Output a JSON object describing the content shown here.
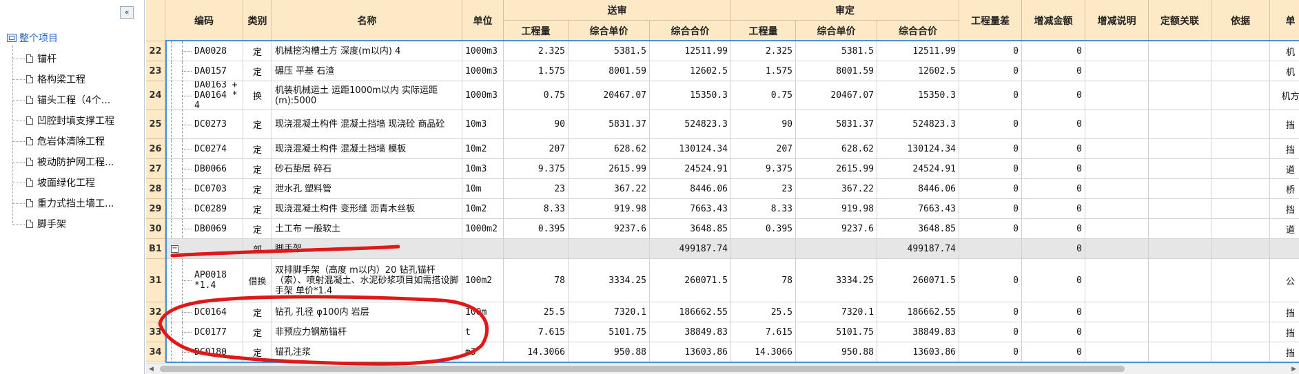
{
  "tree": {
    "collapse_glyph": "«",
    "root_label": "整个项目",
    "items": [
      "锚杆",
      "格构梁工程",
      "锚头工程（4个...",
      "凹腔封填支撑工程",
      "危岩体清除工程",
      "被动防护网工程...",
      "坡面绿化工程",
      "重力式挡土墙工...",
      "脚手架"
    ]
  },
  "header": {
    "code": "编码",
    "type": "类别",
    "name": "名称",
    "unit": "单位",
    "send_group": "送审",
    "approve_group": "审定",
    "qty": "工程量",
    "unit_price": "综合单价",
    "total": "综合合价",
    "qty_diff": "工程量差",
    "amount_diff": "增减金额",
    "diff_note": "增减说明",
    "quota_link": "定额关联",
    "basis": "依据",
    "extra": "单"
  },
  "rows": [
    {
      "num": "22",
      "code": "DA0028",
      "type": "定",
      "name": "机械挖沟槽土方 深度(m以内) 4",
      "unit": "1000m3",
      "q1": "2.325",
      "p1": "5381.5",
      "t1": "12511.99",
      "q2": "2.325",
      "p2": "5381.5",
      "t2": "12511.99",
      "qd": "0",
      "ad": "0",
      "tail": "机"
    },
    {
      "num": "23",
      "code": "DA0157",
      "type": "定",
      "name": "碾压 平基 石渣",
      "unit": "1000m3",
      "q1": "1.575",
      "p1": "8001.59",
      "t1": "12602.5",
      "q2": "1.575",
      "p2": "8001.59",
      "t2": "12602.5",
      "qd": "0",
      "ad": "0",
      "tail": "机"
    },
    {
      "num": "24",
      "code": "DA0163 + DA0164 * 4",
      "type": "换",
      "name": "机装机械运土 运距1000m以内  实际运距(m):5000",
      "unit": "1000m3",
      "q1": "0.75",
      "p1": "20467.07",
      "t1": "15350.3",
      "q2": "0.75",
      "p2": "20467.07",
      "t2": "15350.3",
      "qd": "0",
      "ad": "0",
      "tail": "机方"
    },
    {
      "num": "25",
      "code": "DC0273",
      "type": "定",
      "name": "现浇混凝土构件 混凝土挡墙 现浇砼 商品砼",
      "unit": "10m3",
      "q1": "90",
      "p1": "5831.37",
      "t1": "524823.3",
      "q2": "90",
      "p2": "5831.37",
      "t2": "524823.3",
      "qd": "0",
      "ad": "0",
      "tail": "挡"
    },
    {
      "num": "26",
      "code": "DC0274",
      "type": "定",
      "name": "现浇混凝土构件 混凝土挡墙 模板",
      "unit": "10m2",
      "q1": "207",
      "p1": "628.62",
      "t1": "130124.34",
      "q2": "207",
      "p2": "628.62",
      "t2": "130124.34",
      "qd": "0",
      "ad": "0",
      "tail": "挡"
    },
    {
      "num": "27",
      "code": "DB0066",
      "type": "定",
      "name": "砂石垫层 碎石",
      "unit": "10m3",
      "q1": "9.375",
      "p1": "2615.99",
      "t1": "24524.91",
      "q2": "9.375",
      "p2": "2615.99",
      "t2": "24524.91",
      "qd": "0",
      "ad": "0",
      "tail": "道"
    },
    {
      "num": "28",
      "code": "DC0703",
      "type": "定",
      "name": "泄水孔 塑料管",
      "unit": "10m",
      "q1": "23",
      "p1": "367.22",
      "t1": "8446.06",
      "q2": "23",
      "p2": "367.22",
      "t2": "8446.06",
      "qd": "0",
      "ad": "0",
      "tail": "桥"
    },
    {
      "num": "29",
      "code": "DC0289",
      "type": "定",
      "name": "现浇混凝土构件 变形缝 沥青木丝板",
      "unit": "10m2",
      "q1": "8.33",
      "p1": "919.98",
      "t1": "7663.43",
      "q2": "8.33",
      "p2": "919.98",
      "t2": "7663.43",
      "qd": "0",
      "ad": "0",
      "tail": "挡"
    },
    {
      "num": "30",
      "code": "DB0069",
      "type": "定",
      "name": "土工布 一般软土",
      "unit": "1000m2",
      "q1": "0.395",
      "p1": "9237.6",
      "t1": "3648.85",
      "q2": "0.395",
      "p2": "9237.6",
      "t2": "3648.85",
      "qd": "0",
      "ad": "0",
      "tail": "道"
    },
    {
      "num": "B1",
      "code": "",
      "type": "部",
      "name": "脚手架",
      "unit": "",
      "q1": "",
      "p1": "",
      "t1": "499187.74",
      "q2": "",
      "p2": "",
      "t2": "499187.74",
      "qd": "",
      "ad": "0",
      "tail": "",
      "group": true
    },
    {
      "num": "31",
      "code": "AP0018 *1.4",
      "type": "借换",
      "name": "双排脚手架（高度 m以内）20  钻孔锚杆（索）、喷射混凝土、水泥砂浆项目如需搭设脚手架 单价*1.4",
      "unit": "100m2",
      "q1": "78",
      "p1": "3334.25",
      "t1": "260071.5",
      "q2": "78",
      "p2": "3334.25",
      "t2": "260071.5",
      "qd": "0",
      "ad": "0",
      "tail": "公"
    },
    {
      "num": "32",
      "code": "DC0164",
      "type": "定",
      "name": "钻孔 孔径 φ100内 岩层",
      "unit": "100m",
      "q1": "25.5",
      "p1": "7320.1",
      "t1": "186662.55",
      "q2": "25.5",
      "p2": "7320.1",
      "t2": "186662.55",
      "qd": "0",
      "ad": "0",
      "tail": "挡"
    },
    {
      "num": "33",
      "code": "DC0177",
      "type": "定",
      "name": "非预应力钢筋锚杆",
      "unit": "t",
      "q1": "7.615",
      "p1": "5101.75",
      "t1": "38849.83",
      "q2": "7.615",
      "p2": "5101.75",
      "t2": "38849.83",
      "qd": "0",
      "ad": "0",
      "tail": "挡"
    },
    {
      "num": "34",
      "code": "DC0180",
      "type": "定",
      "name": "锚孔注浆",
      "unit": "m3",
      "q1": "14.3066",
      "p1": "950.88",
      "t1": "13603.86",
      "q2": "14.3066",
      "p2": "950.88",
      "t2": "13603.86",
      "qd": "0",
      "ad": "0",
      "tail": "挡"
    }
  ],
  "colors": {
    "header_bg": "#fde9c6",
    "selection": "#4a90d9",
    "annotation": "#e01818",
    "root_text": "#1d62c9"
  }
}
